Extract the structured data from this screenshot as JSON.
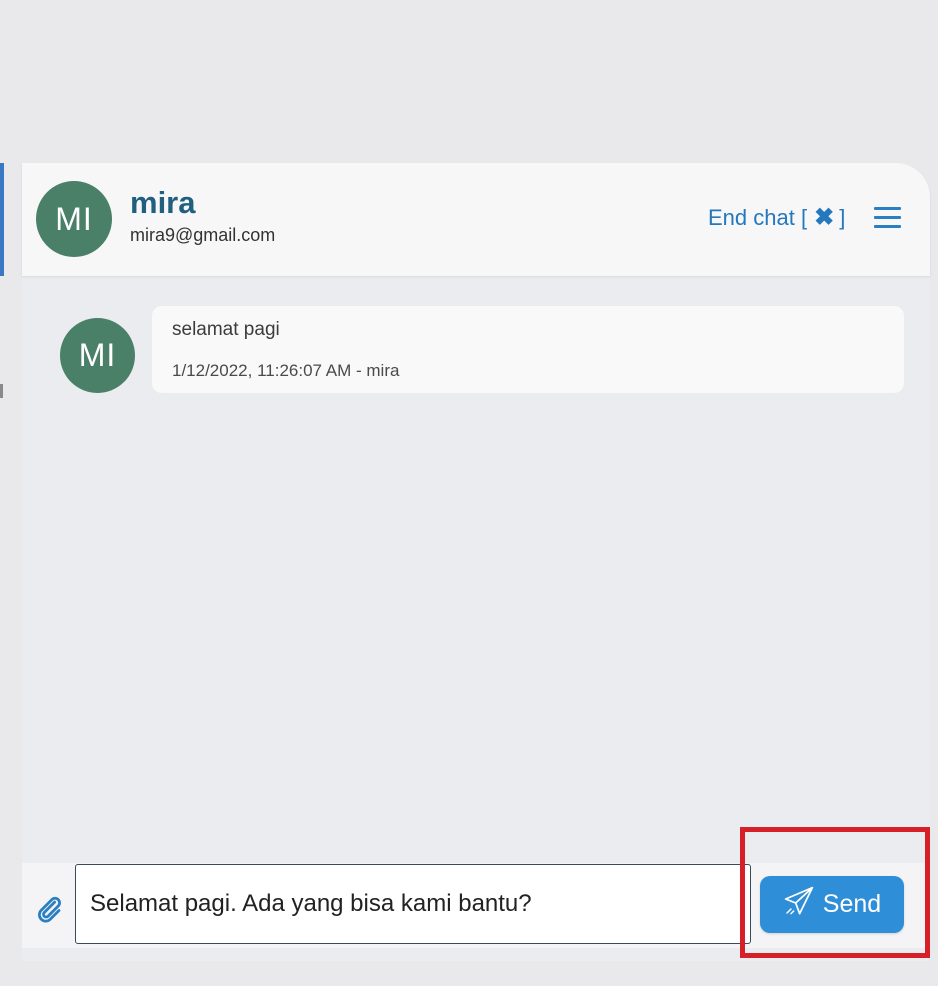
{
  "contact": {
    "initials": "MI",
    "name": "mira",
    "email": "mira9@gmail.com"
  },
  "header": {
    "end_chat_label": "End chat [",
    "end_chat_close": "]",
    "icons": [
      "close-icon",
      "menu-icon"
    ]
  },
  "messages": [
    {
      "initials": "MI",
      "text": "selamat pagi",
      "meta": "1/12/2022, 11:26:07 AM - mira"
    }
  ],
  "composer": {
    "value": "Selamat pagi. Ada yang bisa kami bantu?",
    "send_label": "Send",
    "icons": [
      "paperclip-icon",
      "paper-plane-icon"
    ]
  },
  "colors": {
    "accent": "#2e8fd8",
    "avatar": "#4a7f68",
    "name": "#205f80",
    "highlight": "#d61f26"
  }
}
